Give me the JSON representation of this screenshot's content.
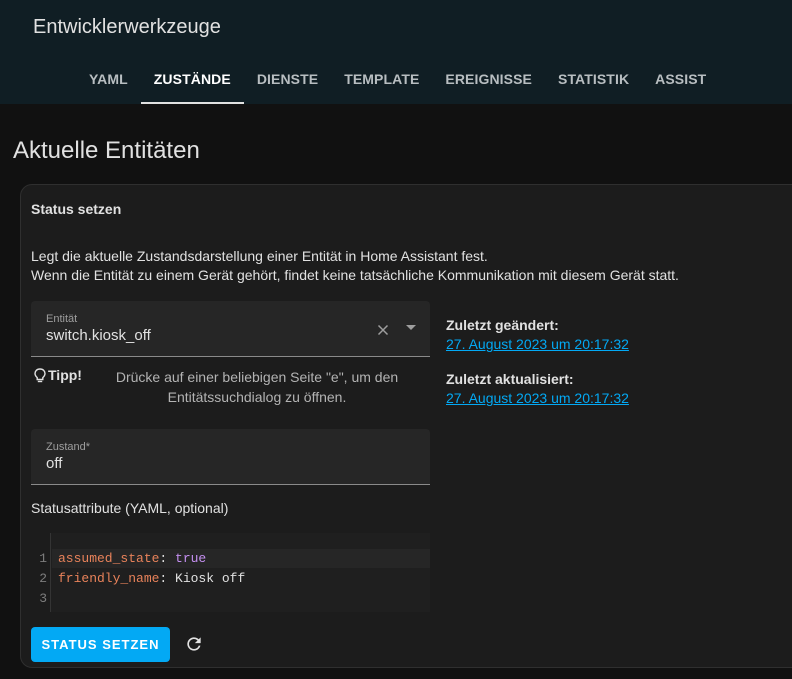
{
  "header": {
    "title": "Entwicklerwerkzeuge",
    "tabs": [
      {
        "label": "YAML",
        "active": false
      },
      {
        "label": "ZUSTÄNDE",
        "active": true
      },
      {
        "label": "DIENSTE",
        "active": false
      },
      {
        "label": "TEMPLATE",
        "active": false
      },
      {
        "label": "EREIGNISSE",
        "active": false
      },
      {
        "label": "STATISTIK",
        "active": false
      },
      {
        "label": "ASSIST",
        "active": false
      }
    ]
  },
  "page": {
    "title": "Aktuelle Entitäten"
  },
  "card": {
    "title": "Status setzen",
    "description_line1": "Legt die aktuelle Zustandsdarstellung einer Entität in Home Assistant fest.",
    "description_line2": "Wenn die Entität zu einem Gerät gehört, findet keine tatsächliche Kommunikation mit diesem Gerät statt.",
    "entity_field": {
      "label": "Entität",
      "value": "switch.kiosk_off"
    },
    "tip": {
      "label": "Tipp!",
      "text_line1": "Drücke auf einer beliebigen Seite \"e\", um den",
      "text_line2": "Entitätssuchdialog zu öffnen."
    },
    "state_field": {
      "label": "Zustand*",
      "value": "off"
    },
    "attributes_label": "Statusattribute (YAML, optional)",
    "code": {
      "line_numbers": [
        "1",
        "2",
        "3"
      ],
      "line1_key": "assumed_state",
      "line1_sep": ": ",
      "line1_value": "true",
      "line2_key": "friendly_name",
      "line2_sep": ": ",
      "line2_value": "Kiosk off",
      "line3": ""
    },
    "last_changed": {
      "label": "Zuletzt geändert:",
      "value": "27. August 2023 um 20:17:32"
    },
    "last_updated": {
      "label": "Zuletzt aktualisiert:",
      "value": "27. August 2023 um 20:17:32"
    },
    "set_state_button": "STATUS SETZEN"
  },
  "colors": {
    "accent": "#03a9f4",
    "header_bg": "#101e24",
    "yaml_key": "#e8825a",
    "yaml_bool": "#c48ff0"
  },
  "icons": {
    "clear": "close-icon",
    "dropdown": "chevron-down-icon",
    "tip": "lightbulb-icon",
    "refresh": "refresh-icon"
  }
}
